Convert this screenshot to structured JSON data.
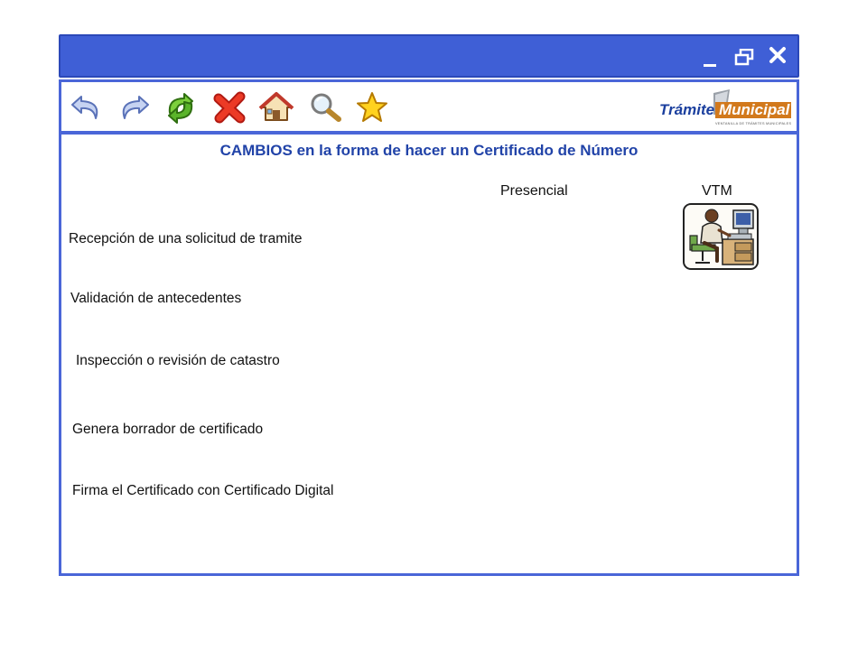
{
  "window": {
    "controls": {
      "minimize": "minimize-icon",
      "restore": "restore-icon",
      "close": "close-icon"
    }
  },
  "toolbar": {
    "icons": [
      "back-arrow-icon",
      "forward-arrow-icon",
      "refresh-icon",
      "delete-icon",
      "home-icon",
      "search-icon",
      "favorite-star-icon"
    ],
    "logo": {
      "main_left": "Trámite",
      "main_right": "Municipal",
      "tagline": "VENTANILLA DE TRÁMITES MUNICIPALES"
    }
  },
  "main": {
    "title": "CAMBIOS en la forma de hacer un Certificado de Número",
    "columns": [
      "Presencial",
      "VTM"
    ],
    "steps": [
      "Recepción de una solicitud de tramite",
      "Validación de antecedentes",
      "Inspección o revisión de catastro",
      "Genera borrador de certificado",
      "Firma el Certificado con Certificado Digital"
    ]
  },
  "colors": {
    "accent": "#3f5fd6",
    "title": "#2143a8"
  }
}
